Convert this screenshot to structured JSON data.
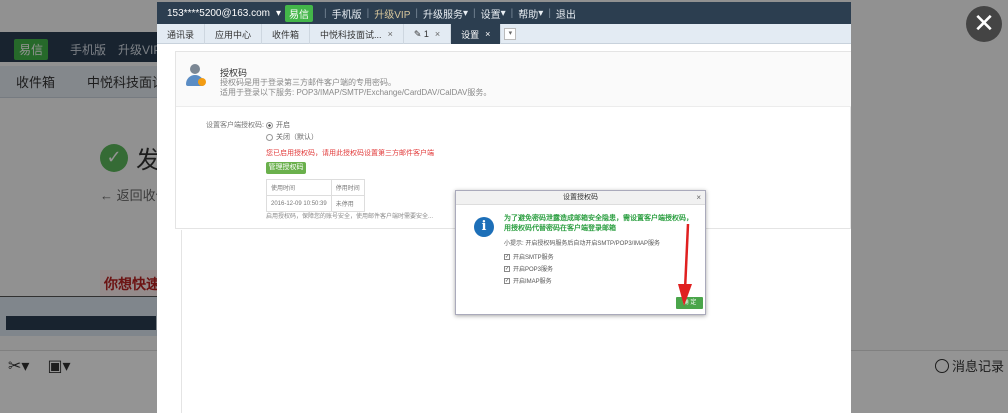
{
  "background": {
    "logo_text": "易信",
    "top_links": [
      "手机版",
      "升级VIP"
    ],
    "tabs": [
      "收件箱",
      "中悦科技面试"
    ],
    "success_text": "发",
    "back_link": "返回收件",
    "banner_text": "你想快速",
    "record_label": "消息记录"
  },
  "topbar": {
    "account": "153****5200@163.com",
    "logo": "易信",
    "links": [
      "手机版",
      "升级VIP",
      "升级服务",
      "设置",
      "帮助",
      "退出"
    ]
  },
  "tabs": [
    {
      "label": "通讯录",
      "closable": false,
      "active": false
    },
    {
      "label": "应用中心",
      "closable": false,
      "active": false
    },
    {
      "label": "收件箱",
      "closable": false,
      "active": false
    },
    {
      "label": "中悦科技面试...",
      "closable": true,
      "active": false
    },
    {
      "label": "1",
      "closable": true,
      "active": false
    },
    {
      "label": "设置",
      "closable": true,
      "active": true
    }
  ],
  "auth": {
    "title": "授权码",
    "desc1": "授权码是用于登录第三方邮件客户端的专用密码。",
    "desc2": "适用于登录以下服务: POP3/IMAP/SMTP/Exchange/CardDAV/CalDAV服务。",
    "setting_label": "设置客户端授权码:",
    "opt_on": "开启",
    "opt_off": "关闭（默认）",
    "warning": "您已启用授权码，请用此授权码设置第三方邮件客户端",
    "manage_button": "管理授权码",
    "table_headers": [
      "使用时间",
      "停用时间"
    ],
    "table_row": [
      "2016-12-09 10:50:39",
      "未停用"
    ],
    "footnote": "启用授权码，保障您的账号安全，使用邮件客户端时需要安全..."
  },
  "dialog": {
    "title": "设置授权码",
    "message": "为了避免密码泄露造成邮箱安全隐患，需设置客户端授权码，用授权码代替密码在客户端登录邮箱",
    "tip": "小提示: 开启授权码服务后自动开启SMTP/POP3/IMAP服务",
    "services": [
      "开启SMTP服务",
      "开启POP3服务",
      "开启IMAP服务"
    ],
    "ok_button": "确 定"
  },
  "colors": {
    "topbar": "#2c3e50",
    "accent_green": "#43b649",
    "warning_red": "#e23b3b",
    "info_blue": "#1d6fb8",
    "arrow_red": "#e02020"
  }
}
